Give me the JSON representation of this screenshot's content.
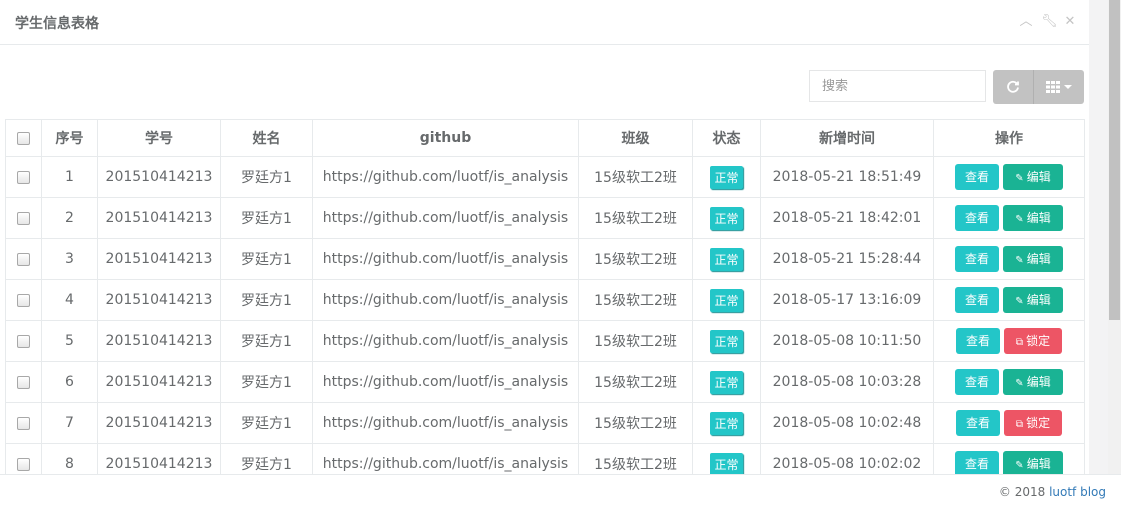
{
  "panel": {
    "title": "学生信息表格",
    "tools": [
      "chevron-up-icon",
      "wrench-icon",
      "close-icon"
    ]
  },
  "toolbar": {
    "search_placeholder": "搜索",
    "refresh_icon": "refresh-icon",
    "columns_icon": "grid-columns-icon"
  },
  "table": {
    "headers": [
      "序号",
      "学号",
      "姓名",
      "github",
      "班级",
      "状态",
      "新增时间",
      "操作"
    ],
    "rows": [
      {
        "idx": "1",
        "sid": "201510414213",
        "name": "罗廷方1",
        "github": "https://github.com/luotf/is_analysis",
        "cls": "15级软工2班",
        "status": "正常",
        "time": "2018-05-21 18:51:49",
        "view": "查看",
        "action": "编辑",
        "action_type": "edit"
      },
      {
        "idx": "2",
        "sid": "201510414213",
        "name": "罗廷方1",
        "github": "https://github.com/luotf/is_analysis",
        "cls": "15级软工2班",
        "status": "正常",
        "time": "2018-05-21 18:42:01",
        "view": "查看",
        "action": "编辑",
        "action_type": "edit"
      },
      {
        "idx": "3",
        "sid": "201510414213",
        "name": "罗廷方1",
        "github": "https://github.com/luotf/is_analysis",
        "cls": "15级软工2班",
        "status": "正常",
        "time": "2018-05-21 15:28:44",
        "view": "查看",
        "action": "编辑",
        "action_type": "edit"
      },
      {
        "idx": "4",
        "sid": "201510414213",
        "name": "罗廷方1",
        "github": "https://github.com/luotf/is_analysis",
        "cls": "15级软工2班",
        "status": "正常",
        "time": "2018-05-17 13:16:09",
        "view": "查看",
        "action": "编辑",
        "action_type": "edit"
      },
      {
        "idx": "5",
        "sid": "201510414213",
        "name": "罗廷方1",
        "github": "https://github.com/luotf/is_analysis",
        "cls": "15级软工2班",
        "status": "正常",
        "time": "2018-05-08 10:11:50",
        "view": "查看",
        "action": "锁定",
        "action_type": "lock"
      },
      {
        "idx": "6",
        "sid": "201510414213",
        "name": "罗廷方1",
        "github": "https://github.com/luotf/is_analysis",
        "cls": "15级软工2班",
        "status": "正常",
        "time": "2018-05-08 10:03:28",
        "view": "查看",
        "action": "编辑",
        "action_type": "edit"
      },
      {
        "idx": "7",
        "sid": "201510414213",
        "name": "罗廷方1",
        "github": "https://github.com/luotf/is_analysis",
        "cls": "15级软工2班",
        "status": "正常",
        "time": "2018-05-08 10:02:48",
        "view": "查看",
        "action": "锁定",
        "action_type": "lock"
      },
      {
        "idx": "8",
        "sid": "201510414213",
        "name": "罗廷方1",
        "github": "https://github.com/luotf/is_analysis",
        "cls": "15级软工2班",
        "status": "正常",
        "time": "2018-05-08 10:02:02",
        "view": "查看",
        "action": "编辑",
        "action_type": "edit"
      }
    ]
  },
  "footer": {
    "prefix": "© 2018",
    "link": "luotf blog"
  },
  "colors": {
    "status": "#23c6c8",
    "edit": "#1ab394",
    "lock": "#ed5565",
    "view": "#23c6c8"
  }
}
